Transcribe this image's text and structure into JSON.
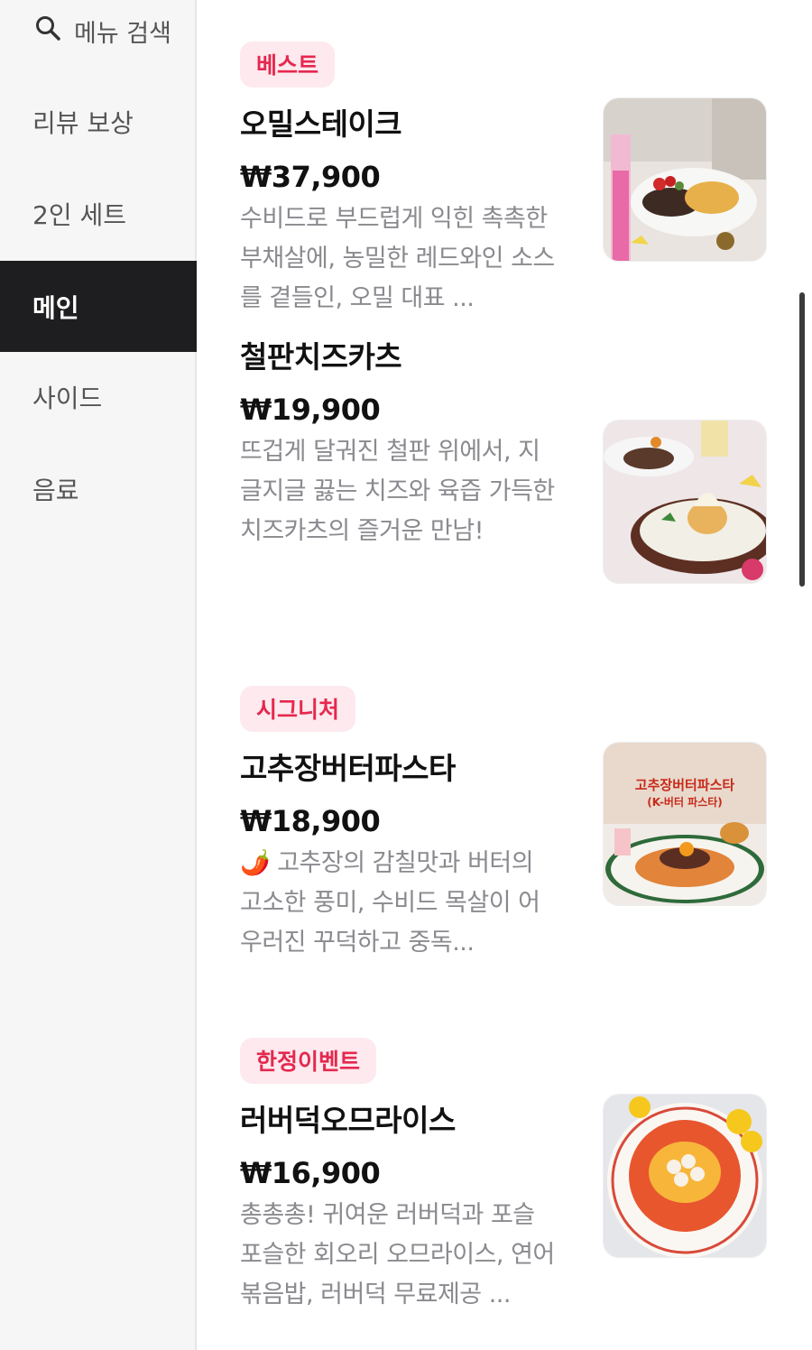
{
  "sidebar": {
    "search_label": "메뉴 검색",
    "items": [
      {
        "label": "리뷰 보상"
      },
      {
        "label": "2인 세트"
      },
      {
        "label": "메인"
      },
      {
        "label": "사이드"
      },
      {
        "label": "음료"
      }
    ],
    "active_index": 2
  },
  "menu": [
    {
      "badge": "베스트",
      "name": "오밀스테이크",
      "price": "₩37,900",
      "desc": "수비드로 부드럽게 익힌 촉촉한 부채살에, 농밀한 레드와인 소스를 곁들인, 오밀 대표 ...",
      "image": "steak-photo"
    },
    {
      "badge": "",
      "name": "철판치즈카츠",
      "price": "₩19,900",
      "desc": "뜨겁게 달궈진 철판 위에서, 지글지글 끓는 치즈와 육즙 가득한 치즈카츠의 즐거운 만남!",
      "image": "cheese-katsu-photo"
    },
    {
      "badge": "시그니처",
      "name": "고추장버터파스타",
      "price": "₩18,900",
      "desc": "🌶️ 고추장의 감칠맛과 버터의 고소한 풍미, 수비드 목살이 어우러진 꾸덕하고 중독...",
      "image": "gochujang-pasta-photo",
      "image_text": [
        "고추장버터파스타",
        "(K-버터 파스타)"
      ]
    },
    {
      "badge": "한정이벤트",
      "name": "러버덕오므라이스",
      "price": "₩16,900",
      "desc": "총총총! 귀여운 러버덕과 포슬포슬한 회오리 오므라이스, 연어볶음밥, 러버덕 무료제공 ...",
      "image": "rubber-duck-omurice-photo"
    }
  ],
  "colors": {
    "badge_text": "#e5284f",
    "badge_bg": "#fde9ee",
    "active_bg": "#1e1e20"
  }
}
